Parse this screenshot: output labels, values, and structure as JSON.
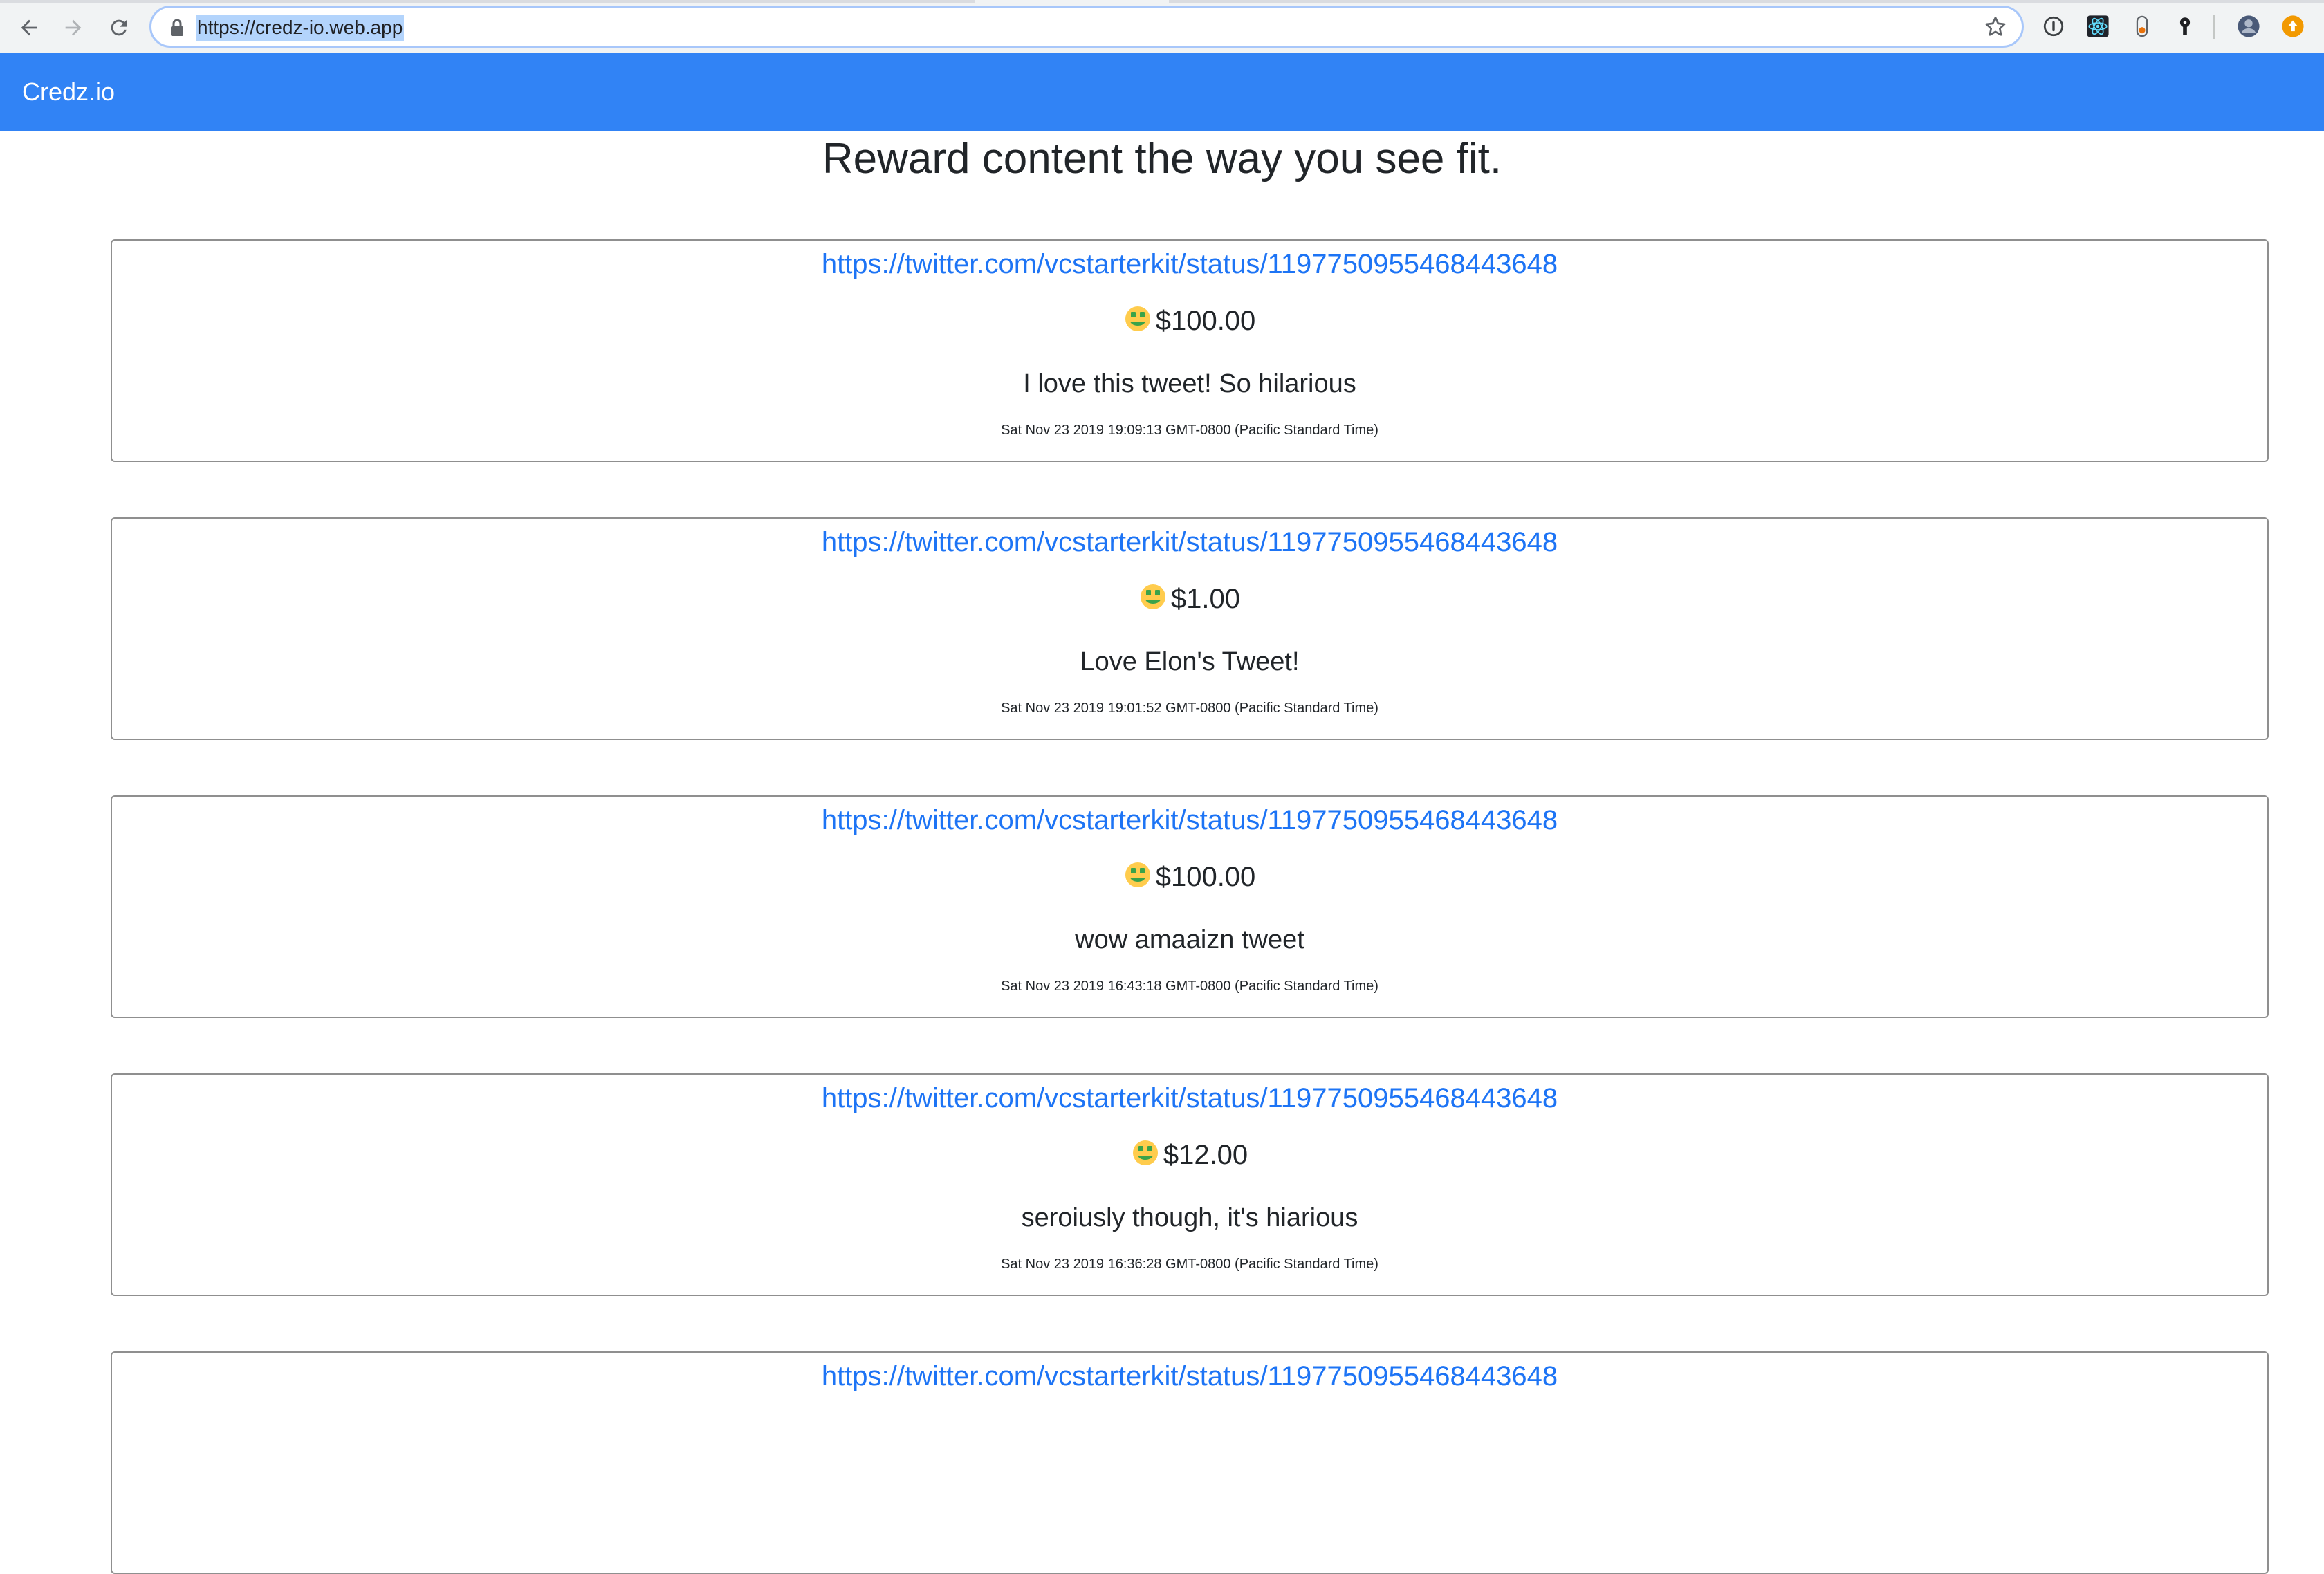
{
  "browser": {
    "address_url": "https://credz-io.web.app"
  },
  "app": {
    "brand": "Credz.io",
    "heading": "Reward content the way you see fit."
  },
  "rewards": [
    {
      "link": "https://twitter.com/vcstarterkit/status/1197750955468443648",
      "amount": "$100.00",
      "message": "I love this tweet! So hilarious",
      "timestamp": "Sat Nov 23 2019 19:09:13 GMT-0800 (Pacific Standard Time)"
    },
    {
      "link": "https://twitter.com/vcstarterkit/status/1197750955468443648",
      "amount": "$1.00",
      "message": "Love Elon's Tweet!",
      "timestamp": "Sat Nov 23 2019 19:01:52 GMT-0800 (Pacific Standard Time)"
    },
    {
      "link": "https://twitter.com/vcstarterkit/status/1197750955468443648",
      "amount": "$100.00",
      "message": "wow amaaizn tweet",
      "timestamp": "Sat Nov 23 2019 16:43:18 GMT-0800 (Pacific Standard Time)"
    },
    {
      "link": "https://twitter.com/vcstarterkit/status/1197750955468443648",
      "amount": "$12.00",
      "message": "seroiusly though, it's hiarious",
      "timestamp": "Sat Nov 23 2019 16:36:28 GMT-0800 (Pacific Standard Time)"
    },
    {
      "link": "https://twitter.com/vcstarterkit/status/1197750955468443648",
      "amount": "",
      "message": "",
      "timestamp": ""
    }
  ],
  "colors": {
    "navbar": "#3183f5",
    "link": "#1d74f5",
    "card_border": "#8f8f8f"
  },
  "icons": {
    "amount": "money-mouth-face-icon"
  }
}
